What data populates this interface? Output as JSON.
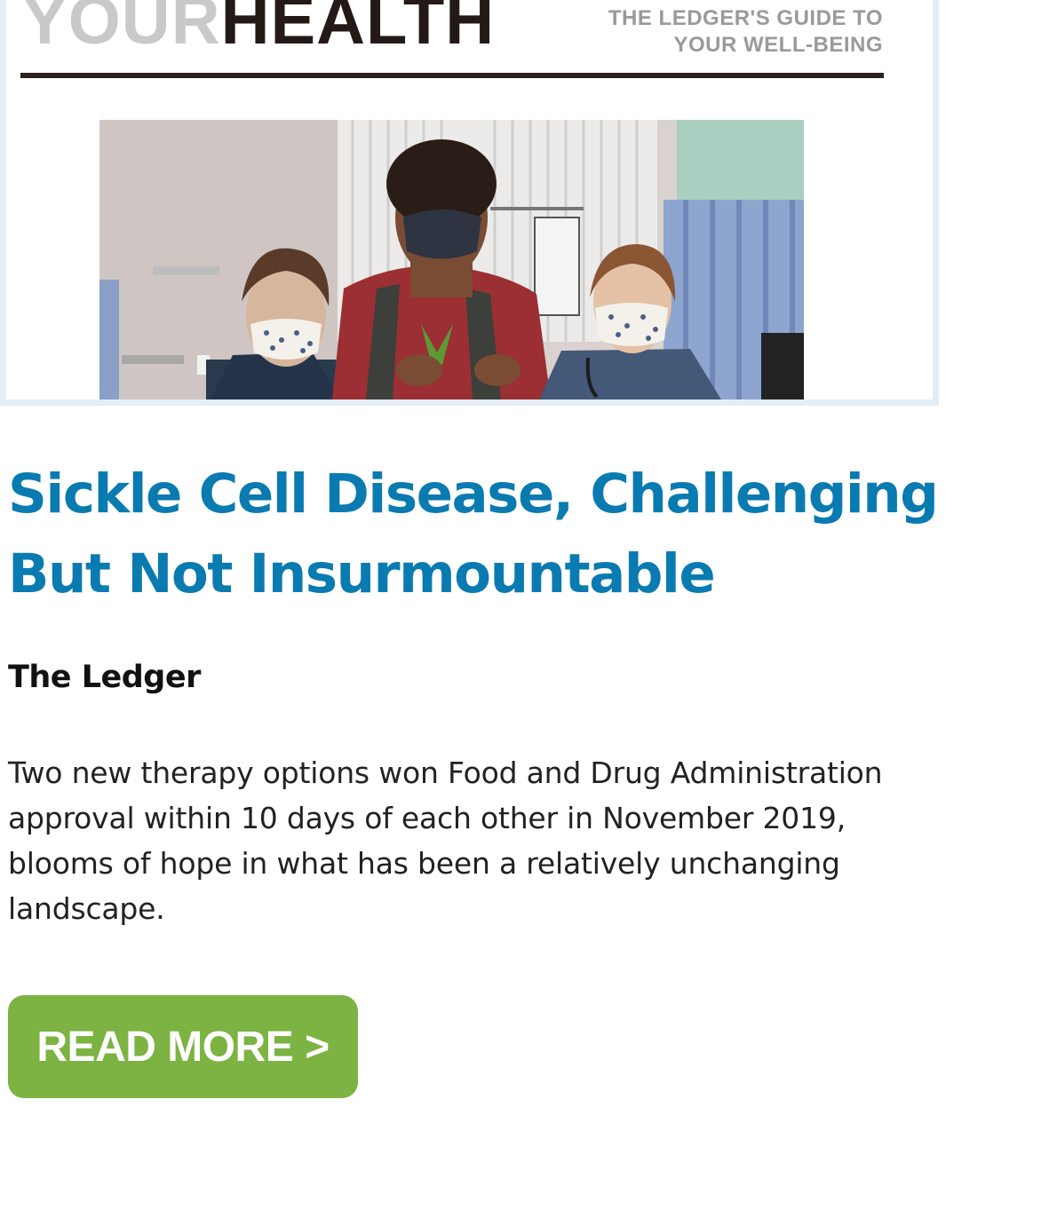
{
  "masthead": {
    "brand_your": "YOUR",
    "brand_health": "HEALTH",
    "tagline_line1": "THE LEDGER'S GUIDE TO",
    "tagline_line2": "YOUR WELL-BEING"
  },
  "article": {
    "headline_line1": "Sickle Cell Disease, Challenging",
    "headline_line2": "But Not Insurmountable",
    "source": "The Ledger",
    "summary": "Two new therapy options won Food and Drug Administration approval within 10 days of each other in November 2019, blooms of hope in what has been a relatively unchanging landscape."
  },
  "cta": {
    "label": "READ MORE >"
  },
  "colors": {
    "headline": "#0a7bb1",
    "cta_background": "#7cb342",
    "frame_border": "#e4eef5"
  }
}
